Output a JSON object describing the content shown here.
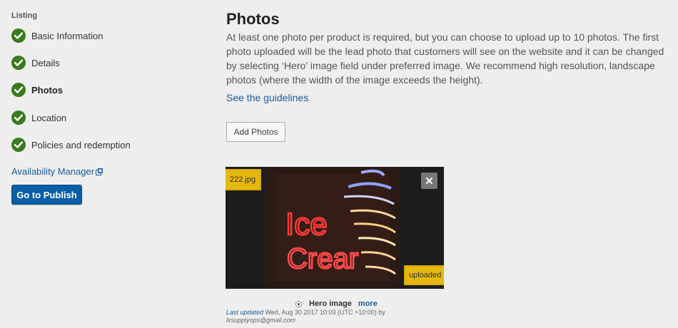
{
  "sidebar": {
    "heading": "Listing",
    "items": [
      {
        "label": "Basic Information",
        "status": "complete"
      },
      {
        "label": "Details",
        "status": "complete"
      },
      {
        "label": "Photos",
        "status": "complete",
        "active": true
      },
      {
        "label": "Location",
        "status": "complete"
      },
      {
        "label": "Policies and redemption",
        "status": "complete"
      }
    ],
    "availability_link": "Availability Manager",
    "publish_button": "Go to Publish"
  },
  "main": {
    "title": "Photos",
    "intro": "At least one photo per product is required, but you can choose to upload up to 10 photos. The first photo uploaded will be the lead photo that customers will see on the website and it can be changed by selecting ‘Hero’ image field under preferred image. We recommend high resolution, landscape photos (where the width of the image exceeds the height).",
    "guidelines_link": "See the guidelines",
    "add_photos_button": "Add Photos",
    "photo": {
      "filename": "222.jpg",
      "status": "uploaded",
      "remove_icon": "close-icon",
      "neon_text_line1": "Ice",
      "neon_text_line2": "Crear",
      "hero_label": "Hero image",
      "more_link": "more",
      "hero_selected": true,
      "last_updated_label": "Last updated",
      "last_updated_value": "Wed, Aug 30 2017 10:03 (UTC +10:00) by",
      "last_updated_by": "lxsupplyops@gmail.com"
    }
  },
  "colors": {
    "background": "#eeeeee",
    "check_green": "#3b7a1f",
    "link_blue": "#1a5b9a",
    "primary_button": "#0a5ea8",
    "badge_yellow": "#e5b80b",
    "neon_red": "#ff3a3a"
  }
}
